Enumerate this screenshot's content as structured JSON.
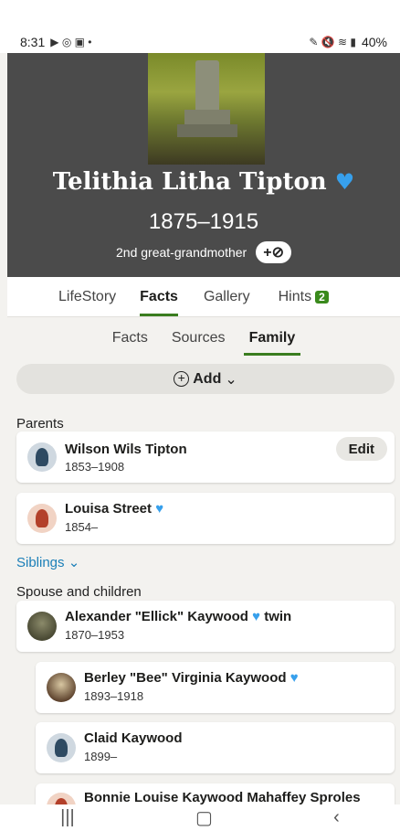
{
  "status_bar": {
    "time": "8:31",
    "battery": "40%"
  },
  "hero": {
    "name": "Telithia Litha Tipton",
    "years": "1875–1915",
    "relationship": "2nd great-grandmother",
    "tag_button": "+⊘"
  },
  "tabs": [
    {
      "label": "LifeStory"
    },
    {
      "label": "Facts"
    },
    {
      "label": "Gallery"
    },
    {
      "label": "Hints"
    }
  ],
  "hints_count": "2",
  "subtabs": [
    {
      "label": "Facts"
    },
    {
      "label": "Sources"
    },
    {
      "label": "Family"
    }
  ],
  "add_label": "Add",
  "parents_label": "Parents",
  "parents": [
    {
      "name": "Wilson Wils Tipton",
      "years": "1853–1908",
      "edit": "Edit"
    },
    {
      "name": "Louisa Street",
      "years": "1854–"
    }
  ],
  "siblings_label": "Siblings",
  "spouse_label": "Spouse and children",
  "spouse": {
    "name": "Alexander \"Ellick\" Kaywood",
    "suffix": "twin",
    "years": "1870–1953"
  },
  "children": [
    {
      "name": "Berley \"Bee\" Virginia Kaywood",
      "years": "1893–1918"
    },
    {
      "name": "Claid Kaywood",
      "years": "1899–"
    },
    {
      "name": "Bonnie Louise Kaywood Mahaffey Sproles",
      "years": ""
    }
  ],
  "colors": {
    "accent_green": "#3a7d1f",
    "heart_blue": "#37a0ec",
    "link_blue": "#1b7fb8"
  }
}
